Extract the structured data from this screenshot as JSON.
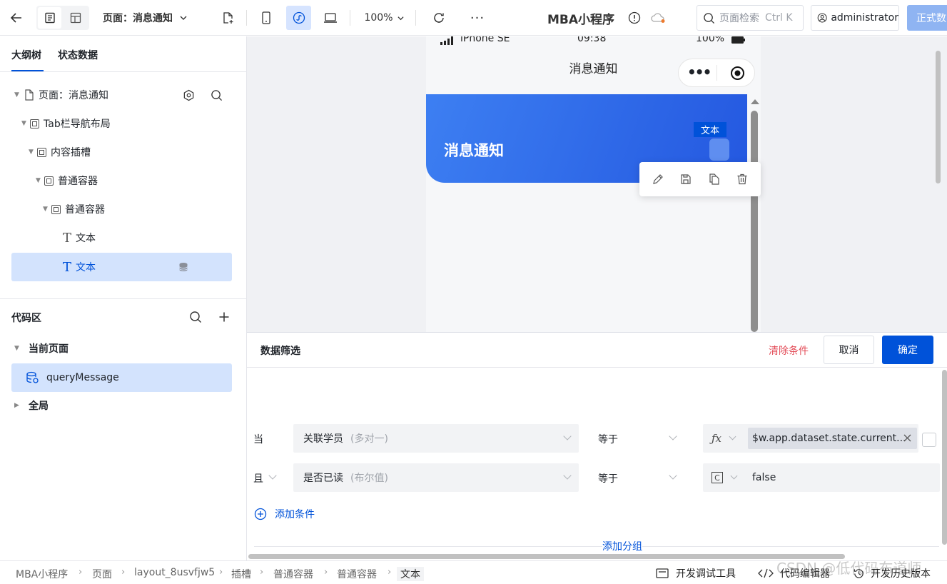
{
  "topbar": {
    "page_selector": "页面：消息通知",
    "zoom": "100%",
    "app_title": "MBA小程序",
    "search_placeholder": "页面检索",
    "search_shortcut": "Ctrl K",
    "user": "administrator",
    "publish_label": "正式数"
  },
  "left": {
    "tabs": [
      "大纲树",
      "状态数据"
    ],
    "tree": [
      {
        "label": "页面：消息通知"
      },
      {
        "label": "Tab栏导航布局"
      },
      {
        "label": "内容插槽"
      },
      {
        "label": "普通容器"
      },
      {
        "label": "普通容器"
      },
      {
        "label": "文本"
      },
      {
        "label": "文本"
      }
    ],
    "code_title": "代码区",
    "current_page": "当前页面",
    "query": "queryMessage",
    "global": "全局"
  },
  "phone": {
    "carrier": "iPhone SE",
    "time": "09:38",
    "battery": "100%",
    "nav_title": "消息通知",
    "banner_title": "消息通知",
    "text_tag": "文本"
  },
  "filter": {
    "title": "数据筛选",
    "clear": "清除条件",
    "cancel": "取消",
    "confirm": "确定",
    "row1": {
      "prefix": "当",
      "field": "关联学员",
      "field_hint": "(多对一)",
      "op": "等于",
      "value": "$w.app.dataset.state.current..."
    },
    "row2": {
      "prefix": "且",
      "field": "是否已读",
      "field_hint": "(布尔值)",
      "op": "等于",
      "value": "false"
    },
    "add_condition": "添加条件",
    "add_group": "添加分组"
  },
  "status": {
    "breadcrumbs": [
      "MBA小程序",
      "页面",
      "layout_8usvfjw5",
      "插槽",
      "普通容器",
      "普通容器",
      "文本"
    ],
    "debug_tools": "开发调试工具",
    "code_editor": "代码编辑器",
    "history": "开发历史版本",
    "watermark": "CSDN @低代码布道师"
  },
  "colors": {
    "accent": "#0052d9",
    "banner_start": "#3d7ff2",
    "banner_end": "#2458e0",
    "clear": "#e34d59"
  }
}
